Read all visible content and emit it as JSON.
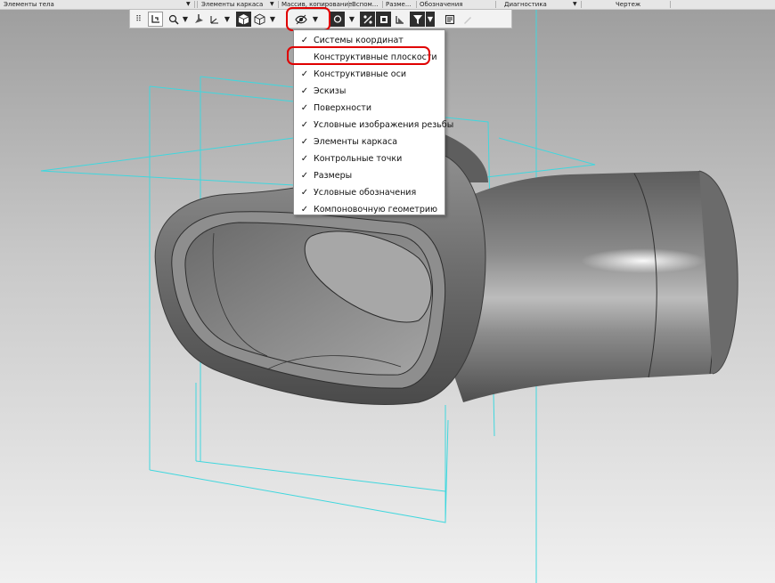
{
  "ribbon_tabs": [
    {
      "label": "Элементы тела"
    },
    {
      "label": "Элементы каркаса"
    },
    {
      "label": "Массив, копирование"
    },
    {
      "label": "Вспом..."
    },
    {
      "label": "Разме..."
    },
    {
      "label": "Обозначения"
    },
    {
      "label": "Диагностика"
    },
    {
      "label": "Чертеж"
    }
  ],
  "visibility_menu": {
    "items": [
      {
        "label": "Системы координат",
        "checked": true
      },
      {
        "label": "Конструктивные плоскости",
        "checked": false
      },
      {
        "label": "Конструктивные оси",
        "checked": true
      },
      {
        "label": "Эскизы",
        "checked": true
      },
      {
        "label": "Поверхности",
        "checked": true
      },
      {
        "label": "Условные изображения резьбы",
        "checked": true
      },
      {
        "label": "Элементы каркаса",
        "checked": true
      },
      {
        "label": "Контрольные точки",
        "checked": true
      },
      {
        "label": "Размеры",
        "checked": true
      },
      {
        "label": "Условные обозначения",
        "checked": true
      },
      {
        "label": "Компоновочную геометрию",
        "checked": true
      }
    ],
    "check_glyph": "✓"
  },
  "icons": {
    "dropdown": "▼",
    "grip": "⠿"
  },
  "colors": {
    "plane_lines": "#3fd7de",
    "highlight": "#e00000",
    "part_body": "#7a7a7a",
    "background_top": "#9a9a9a",
    "background_bottom": "#eeeeee"
  }
}
